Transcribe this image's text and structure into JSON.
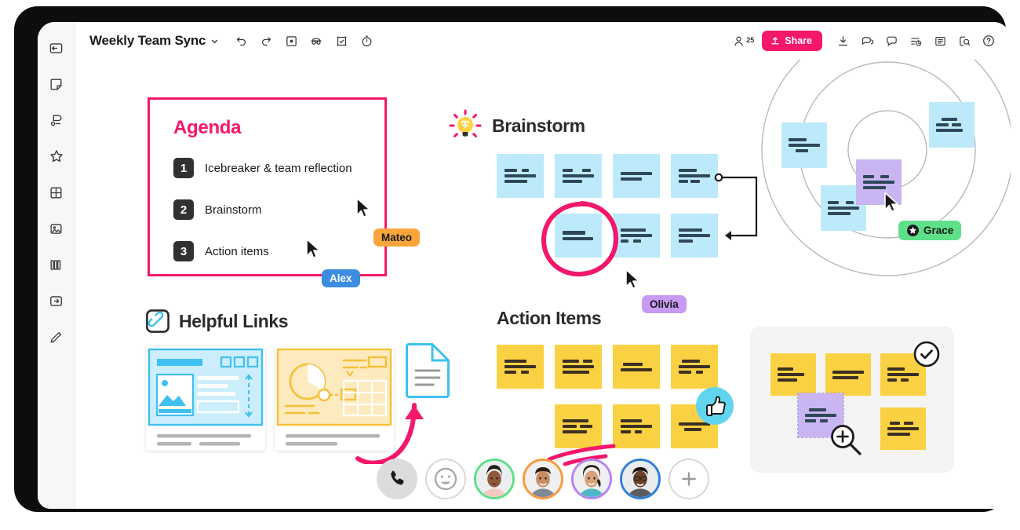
{
  "window": {
    "frame_color": "#0d0d0d",
    "canvas_bg": "#ffffff"
  },
  "topbar": {
    "title": "Weekly Team Sync",
    "title_caret_icon": "chevron-down-icon",
    "tools": [
      {
        "name": "undo-icon",
        "label": "Undo"
      },
      {
        "name": "redo-icon",
        "label": "Redo"
      },
      {
        "name": "select-frame-icon",
        "label": "Select"
      },
      {
        "name": "presenter-icon",
        "label": "Presenter mode"
      },
      {
        "name": "vote-icon",
        "label": "Voting"
      },
      {
        "name": "timer-icon",
        "label": "Timer"
      }
    ],
    "people": {
      "icon": "person-icon",
      "count": "25"
    },
    "share": {
      "label": "Share",
      "icon": "upload-icon",
      "color": "#f4176b"
    },
    "right_tools": [
      {
        "name": "download-icon",
        "label": "Download"
      },
      {
        "name": "comments-icon",
        "label": "Comments"
      },
      {
        "name": "chat-icon",
        "label": "Chat"
      },
      {
        "name": "activity-icon",
        "label": "Activity"
      },
      {
        "name": "list-icon",
        "label": "List view"
      },
      {
        "name": "find-icon",
        "label": "Find"
      },
      {
        "name": "help-icon",
        "label": "Help"
      }
    ]
  },
  "sidebar": {
    "items": [
      {
        "name": "collapse-panel-icon",
        "label": "Collapse panel"
      },
      {
        "name": "sticky-note-icon",
        "label": "Sticky note"
      },
      {
        "name": "shapes-icon",
        "label": "Shapes"
      },
      {
        "name": "star-icon",
        "label": "Favorites"
      },
      {
        "name": "grid-icon",
        "label": "Grid / table"
      },
      {
        "name": "image-icon",
        "label": "Image"
      },
      {
        "name": "library-icon",
        "label": "Library"
      },
      {
        "name": "frame-icon",
        "label": "Frame"
      },
      {
        "name": "pen-icon",
        "label": "Pen"
      }
    ]
  },
  "agenda": {
    "title": "Agenda",
    "border_color": "#f4176b",
    "items": [
      {
        "num": "1",
        "text": "Icebreaker & team reflection"
      },
      {
        "num": "2",
        "text": "Brainstorm"
      },
      {
        "num": "3",
        "text": "Action items"
      }
    ]
  },
  "sections": {
    "brainstorm": {
      "title": "Brainstorm",
      "icon": "lightbulb-icon",
      "note_color": "#bdeafb"
    },
    "helpful_links": {
      "title": "Helpful Links",
      "icon": "link-chain-icon"
    },
    "action_items": {
      "title": "Action Items",
      "note_color": "#fad142"
    }
  },
  "cursors": [
    {
      "name": "Mateo",
      "bg": "#f9a53b",
      "text_color": "#1a1a1a"
    },
    {
      "name": "Alex",
      "bg": "#3c8ce0",
      "text_color": "#ffffff"
    },
    {
      "name": "Olivia",
      "bg": "#c79af3",
      "text_color": "#1a1a1a"
    },
    {
      "name": "Grace",
      "bg": "#5de088",
      "text_color": "#1a1a1a",
      "icon": "star-badge-icon"
    }
  ],
  "brainstorm_notes": {
    "row1": [
      {
        "lines": [
          40,
          22,
          100,
          72
        ]
      },
      {
        "lines": [
          34,
          26,
          100,
          62
        ]
      },
      {
        "lines": [
          100,
          66
        ]
      },
      {
        "lines": [
          58,
          100,
          30,
          28
        ]
      }
    ],
    "row2": [
      {
        "lines": [
          72,
          96
        ]
      },
      {
        "lines": [
          80,
          100,
          26,
          24
        ]
      },
      {
        "lines": [
          74,
          100,
          44
        ]
      }
    ]
  },
  "action_notes": {
    "row1": [
      {
        "lines": [
          70,
          100,
          38,
          26
        ]
      },
      {
        "lines": [
          52,
          30,
          100,
          84
        ]
      },
      {
        "lines": [
          62,
          100
        ]
      },
      {
        "lines": [
          56,
          100,
          40,
          22
        ]
      }
    ],
    "row2": [
      {
        "lines": [
          82,
          44,
          38,
          76
        ]
      },
      {
        "lines": [
          66,
          100,
          32,
          24
        ]
      },
      {
        "lines": [
          100,
          54
        ]
      }
    ]
  },
  "cluster_notes": [
    {
      "color": "#bdeafb",
      "lines": [
        58,
        100,
        40
      ]
    },
    {
      "color": "#bdeafb",
      "lines": [
        52,
        76,
        100
      ]
    },
    {
      "color": "#c9b5f2",
      "lines": [
        34,
        28,
        100,
        72
      ]
    },
    {
      "color": "#bdeafb",
      "lines": [
        34,
        26,
        100,
        72
      ]
    }
  ],
  "group_notes": [
    {
      "color": "#fad142",
      "lines": [
        50,
        80,
        62
      ]
    },
    {
      "color": "#fad142",
      "lines": [
        100,
        82
      ]
    },
    {
      "color": "#fad142",
      "lines": [
        56,
        100,
        30,
        26
      ]
    },
    {
      "color": "#c9b5f2",
      "lines": [
        56,
        100,
        34,
        26
      ]
    },
    {
      "color": "#fad142",
      "lines": [
        34,
        30,
        100,
        74
      ]
    }
  ],
  "reactions": {
    "thumbs_up": {
      "icon": "thumbs-up-icon",
      "bg": "#61d5ef"
    },
    "check_badge": {
      "icon": "check-circle-icon"
    },
    "zoom_cursor": {
      "icon": "zoom-in-icon"
    }
  },
  "link_previews": [
    {
      "name": "webpage-preview",
      "accent": "#3fc0f0",
      "fill": "#cceefc"
    },
    {
      "name": "dashboard-preview",
      "accent": "#f5c035",
      "fill": "#fdeabf"
    },
    {
      "name": "document-preview",
      "accent": "#3fc0f0"
    }
  ],
  "avatarbar": {
    "call_icon": "phone-icon",
    "reaction_icon": "emoji-icon",
    "add_icon": "plus-icon",
    "participants": [
      {
        "ring": "#5de088",
        "skin": "#8d5a3b",
        "hair": "#241a14",
        "shirt": "#f2c9c1"
      },
      {
        "ring": "#f79a3c",
        "skin": "#c98c63",
        "hair": "#2a1c12",
        "shirt": "#7d8a93"
      },
      {
        "ring": "#b684f0",
        "skin": "#d6a179",
        "hair": "#2b1b10",
        "shirt": "#4fb8c4"
      },
      {
        "ring": "#2e7fe0",
        "skin": "#6d4228",
        "hair": "#17110c",
        "shirt": "#5c5c60"
      }
    ]
  }
}
